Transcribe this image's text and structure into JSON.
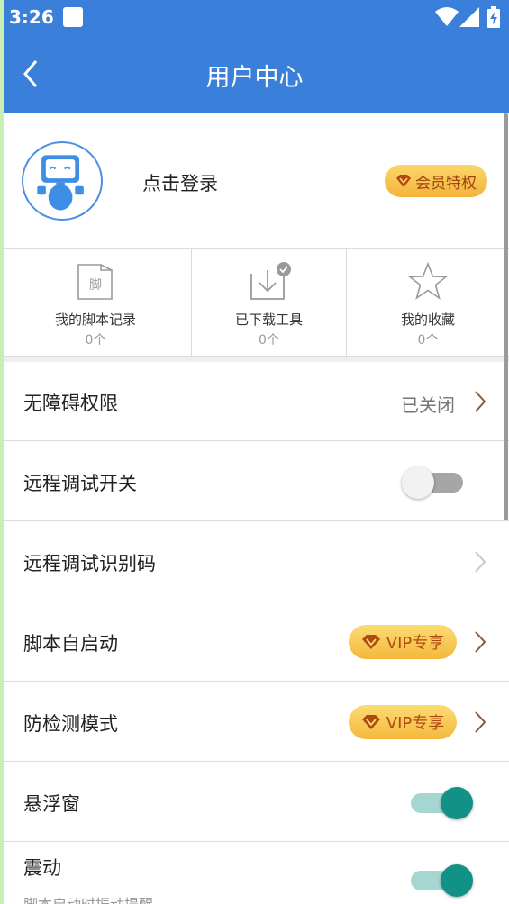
{
  "status": {
    "time": "3:26"
  },
  "header": {
    "title": "用户中心"
  },
  "profile": {
    "login_label": "点击登录",
    "vip_label": "会员特权"
  },
  "shortcuts": [
    {
      "icon": "script-file-icon",
      "icon_text": "脚",
      "label": "我的脚本记录",
      "count": "0个"
    },
    {
      "icon": "download-tool-icon",
      "label": "已下载工具",
      "count": "0个"
    },
    {
      "icon": "star-icon",
      "label": "我的收藏",
      "count": "0个"
    }
  ],
  "settings": [
    {
      "label": "无障碍权限",
      "value": "已关闭"
    },
    {
      "label": "远程调试开关",
      "toggle": false
    },
    {
      "label": "远程调试识别码"
    },
    {
      "label": "脚本自启动",
      "badge": "VIP专享"
    },
    {
      "label": "防检测模式",
      "badge": "VIP专享"
    },
    {
      "label": "悬浮窗",
      "toggle": true
    },
    {
      "label": "震动",
      "sublabel": "脚本启动时振动提醒",
      "toggle": true
    }
  ],
  "colors": {
    "primary": "#3a80da",
    "vip_gold": "#f3b83d",
    "toggle_on": "#129287"
  }
}
